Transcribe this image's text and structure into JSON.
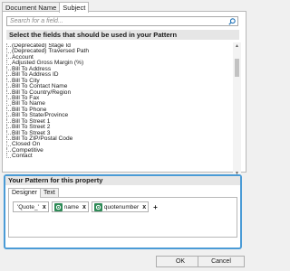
{
  "tabs": [
    {
      "label": "Document Name"
    },
    {
      "label": "Subject"
    }
  ],
  "search": {
    "placeholder": "Search for a field..."
  },
  "fields_header": "Select the fields that should be used in your Pattern",
  "fields": [
    "(Deprecated) Stage Id",
    "(Deprecated) Traversed Path",
    "Account",
    "Adjusted Gross Margin (%)",
    "Bill To Address",
    "Bill To Address ID",
    "Bill To City",
    "Bill To Contact Name",
    "Bill To Country/Region",
    "Bill To Fax",
    "Bill To Name",
    "Bill To Phone",
    "Bill To State/Province",
    "Bill To Street 1",
    "Bill To Street 2",
    "Bill To Street 3",
    "Bill To ZIP/Postal Code",
    "Closed On",
    "Competitive",
    "Contact"
  ],
  "pattern": {
    "header": "Your Pattern for this property",
    "tabs": [
      {
        "label": "Designer"
      },
      {
        "label": "Text"
      }
    ],
    "tokens": [
      {
        "text": "'Quote_'",
        "type": "text"
      },
      {
        "text": "name",
        "type": "field"
      },
      {
        "text": "quotenumber",
        "type": "field"
      }
    ],
    "add_label": "+",
    "remove_label": "x"
  },
  "buttons": {
    "ok": "OK",
    "cancel": "Cancel"
  },
  "colors": {
    "accent": "#4a9bd6",
    "field_token": "#2e8b57"
  }
}
